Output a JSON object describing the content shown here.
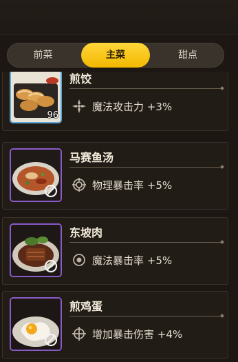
{
  "tabs": [
    "前菜",
    "主菜",
    "甜点"
  ],
  "active_tab": "主菜",
  "dishes": [
    {
      "name": "煎饺",
      "buff": "魔法攻击力 +3%",
      "count": "96",
      "rarity": "blue",
      "locked": false,
      "buff_icon": "magic-attack-icon"
    },
    {
      "name": "马赛鱼汤",
      "buff": "物理暴击率 +5%",
      "count": "",
      "rarity": "purple",
      "locked": true,
      "buff_icon": "crosshair-icon"
    },
    {
      "name": "东坡肉",
      "buff": "魔法暴击率 +5%",
      "count": "",
      "rarity": "purple",
      "locked": true,
      "buff_icon": "target-dot-icon"
    },
    {
      "name": "煎鸡蛋",
      "buff": "增加暴击伤害 +4%",
      "count": "",
      "rarity": "purple",
      "locked": true,
      "buff_icon": "crit-damage-icon"
    }
  ],
  "colors": {
    "accent": "#f5c21a",
    "blue_frame": "#5aa6d8",
    "purple_frame": "#8b5ac9"
  }
}
